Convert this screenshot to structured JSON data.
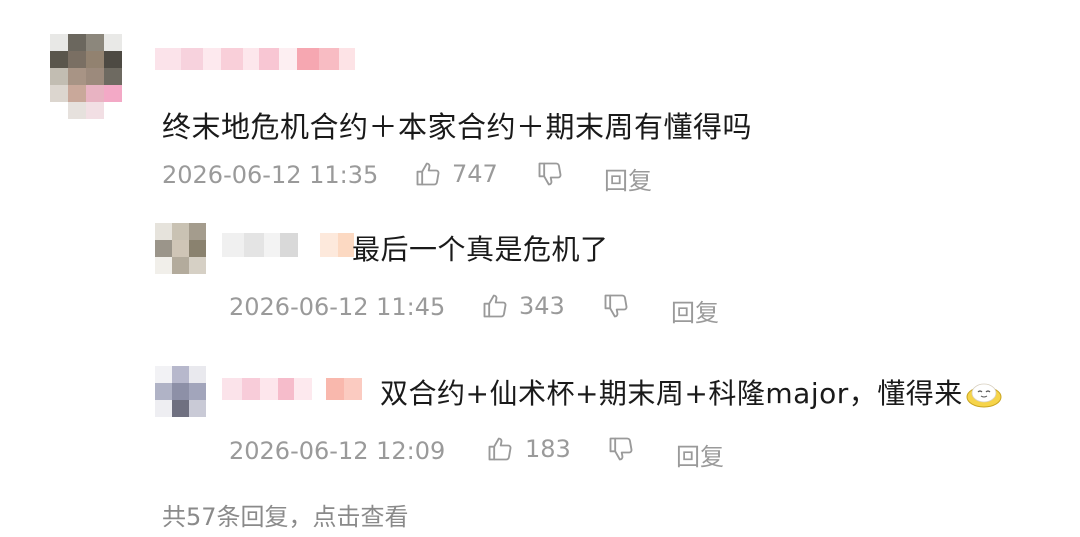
{
  "comment": {
    "text": "终末地危机合约＋本家合约＋期末周有懂得吗",
    "time": "2026-06-12 11:35",
    "likes": "747",
    "reply_label": "回复"
  },
  "replies": [
    {
      "text": "最后一个真是危机了",
      "time": "2026-06-12 11:45",
      "likes": "343",
      "reply_label": "回复"
    },
    {
      "text": "双合约+仙术杯+期末周+科隆major，懂得来",
      "emoji": "tearful-laugh-emoji",
      "time": "2026-06-12 12:09",
      "likes": "183",
      "reply_label": "回复"
    }
  ],
  "more_replies": "共57条回复，点击查看",
  "icons": {
    "like": "thumbs-up-icon",
    "dislike": "thumbs-down-icon"
  },
  "colors": {
    "meta_text": "#9a9a9a",
    "main_text": "#1a1a1a"
  }
}
